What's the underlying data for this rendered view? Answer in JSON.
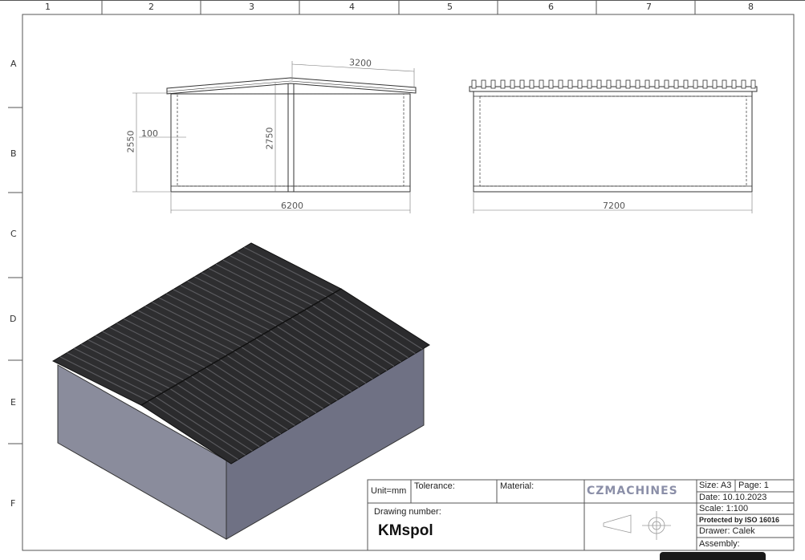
{
  "sheet": {
    "columns": [
      "1",
      "2",
      "3",
      "4",
      "5",
      "6",
      "7",
      "8"
    ],
    "rows": [
      "A",
      "B",
      "C",
      "D",
      "E",
      "F"
    ]
  },
  "dimensions": {
    "front_half_width": "3200",
    "front_wall_height": "2550",
    "front_ridge_height": "2750",
    "front_offset": "100",
    "front_total_width": "6200",
    "side_total_length": "7200"
  },
  "title_block": {
    "unit": "Unit=mm",
    "tolerance_label": "Tolerance:",
    "material_label": "Material:",
    "drawing_number_label": "Drawing number:",
    "drawing_number": "KMspol",
    "logo_text": "CZMACHINES",
    "size": "Size: A3",
    "page": "Page:  1",
    "date": "Date:   10.10.2023",
    "scale": "Scale:   1:100",
    "protection": "Protected by ISO 16016",
    "drawer": "Drawer:  Calek",
    "assembly": "Assembly:"
  },
  "colors": {
    "line": "#333333",
    "roof_dark": "#2b2b2d",
    "wall_left": "#8a8c9c",
    "wall_right": "#6f7184",
    "logo": "#8b8fa8"
  }
}
